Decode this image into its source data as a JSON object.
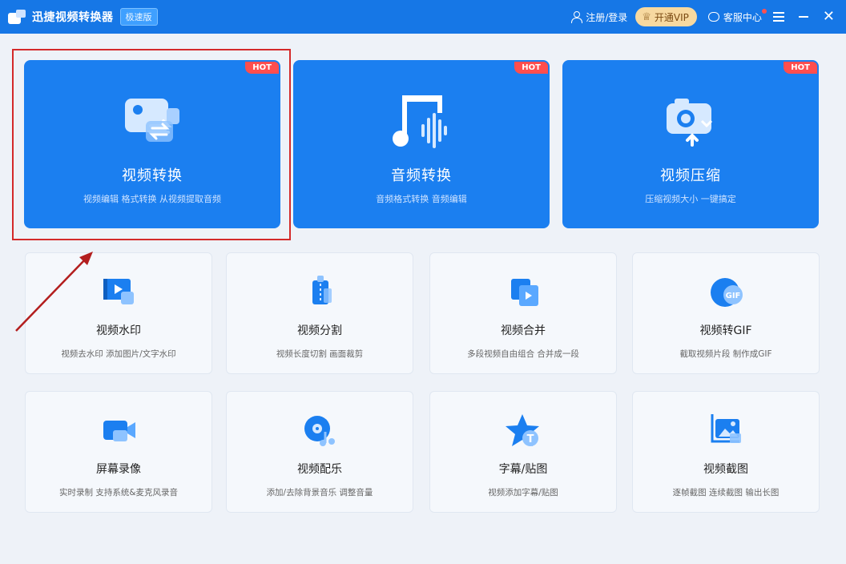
{
  "app": {
    "title": "迅捷视频转换器",
    "edition": "极速版"
  },
  "header": {
    "login": "注册/登录",
    "vip": "开通VIP",
    "service": "客服中心"
  },
  "colors": {
    "titlebar": "#1677e6",
    "card_blue": "#1b7ff0",
    "hot": "#ff4e4e",
    "vip": "#f7d9a0",
    "highlight": "#d42a2a"
  },
  "featured": [
    {
      "title": "视频转换",
      "desc": "视频编辑 格式转换 从视频提取音频",
      "badge": "HOT",
      "icon": "video-convert-icon"
    },
    {
      "title": "音频转换",
      "desc": "音频格式转换 音频编辑",
      "badge": "HOT",
      "icon": "music-note-icon"
    },
    {
      "title": "视频压缩",
      "desc": "压缩视频大小 一键搞定",
      "badge": "HOT",
      "icon": "camera-compress-icon"
    }
  ],
  "tools": [
    {
      "title": "视频水印",
      "desc": "视频去水印 添加图片/文字水印",
      "icon": "video-watermark-icon"
    },
    {
      "title": "视频分割",
      "desc": "视频长度切割 画面裁剪",
      "icon": "video-split-icon"
    },
    {
      "title": "视频合并",
      "desc": "多段视频自由组合 合并成一段",
      "icon": "video-merge-icon"
    },
    {
      "title": "视频转GIF",
      "desc": "截取视频片段 制作成GIF",
      "icon": "gif-icon"
    },
    {
      "title": "屏幕录像",
      "desc": "实时录制 支持系统&麦克风录音",
      "icon": "screen-record-icon"
    },
    {
      "title": "视频配乐",
      "desc": "添加/去除背景音乐 调整音量",
      "icon": "video-music-icon"
    },
    {
      "title": "字幕/贴图",
      "desc": "视频添加字幕/贴图",
      "icon": "subtitle-sticker-icon"
    },
    {
      "title": "视频截图",
      "desc": "逐帧截图 连续截图 输出长图",
      "icon": "video-screenshot-icon"
    }
  ]
}
